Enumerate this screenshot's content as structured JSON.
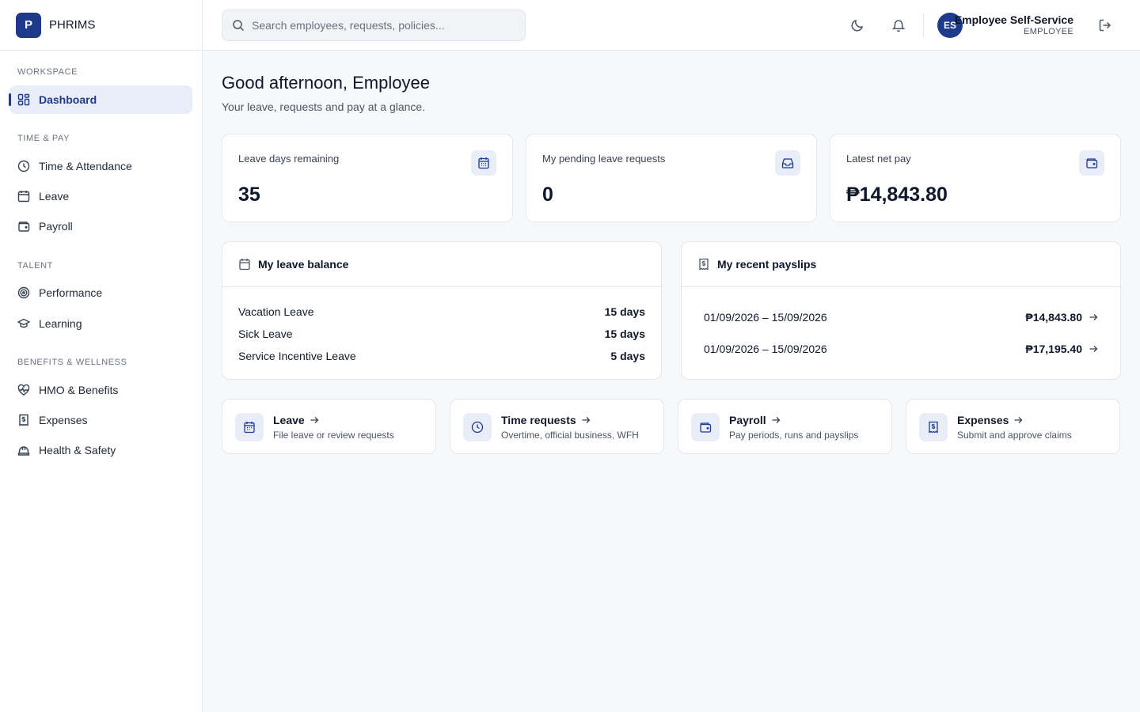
{
  "brand": {
    "logo_letter": "P",
    "name": "PHRIMS"
  },
  "sidebar": {
    "sections": [
      {
        "label": "WORKSPACE"
      },
      {
        "label": "TIME & PAY"
      },
      {
        "label": "TALENT"
      },
      {
        "label": "BENEFITS & WELLNESS"
      }
    ],
    "items": [
      {
        "label": "Dashboard",
        "icon": "dashboard-icon",
        "active": true
      },
      {
        "label": "Time & Attendance",
        "icon": "clock-icon"
      },
      {
        "label": "Leave",
        "icon": "calendar-icon"
      },
      {
        "label": "Payroll",
        "icon": "wallet-icon"
      },
      {
        "label": "Performance",
        "icon": "target-icon"
      },
      {
        "label": "Learning",
        "icon": "graduation-cap-icon"
      },
      {
        "label": "HMO & Benefits",
        "icon": "heart-pulse-icon"
      },
      {
        "label": "Expenses",
        "icon": "receipt-icon"
      },
      {
        "label": "Health & Safety",
        "icon": "hard-hat-icon"
      }
    ]
  },
  "topbar": {
    "search_placeholder": "Search employees, requests, policies...",
    "user": {
      "initials": "ES",
      "name": "Employee Self-Service",
      "role": "EMPLOYEE"
    }
  },
  "main": {
    "greeting": "Good afternoon, Employee",
    "subtitle": "Your leave, requests and pay at a glance.",
    "stats": [
      {
        "label": "Leave days remaining",
        "value": "35",
        "icon": "calendar-icon"
      },
      {
        "label": "My pending leave requests",
        "value": "0",
        "icon": "inbox-icon"
      },
      {
        "label": "Latest net pay",
        "value": "₱14,843.80",
        "icon": "wallet-icon"
      }
    ],
    "leave_balance": {
      "title": "My leave balance",
      "rows": [
        {
          "name": "Vacation Leave",
          "value": "15 days"
        },
        {
          "name": "Sick Leave",
          "value": "15 days"
        },
        {
          "name": "Service Incentive Leave",
          "value": "5 days"
        }
      ]
    },
    "payslips": {
      "title": "My recent payslips",
      "rows": [
        {
          "period": "01/09/2026 – 15/09/2026",
          "amount": "₱14,843.80"
        },
        {
          "period": "01/09/2026 – 15/09/2026",
          "amount": "₱17,195.40"
        }
      ]
    },
    "quick_links": [
      {
        "title": "Leave",
        "desc": "File leave or review requests",
        "icon": "calendar-icon"
      },
      {
        "title": "Time requests",
        "desc": "Overtime, official business, WFH",
        "icon": "clock-icon"
      },
      {
        "title": "Payroll",
        "desc": "Pay periods, runs and payslips",
        "icon": "wallet-icon"
      },
      {
        "title": "Expenses",
        "desc": "Submit and approve claims",
        "icon": "receipt-icon"
      }
    ]
  },
  "colors": {
    "accent": "#1e3a8a",
    "accent_soft": "#e8edf7",
    "background": "#f7f8fa"
  }
}
